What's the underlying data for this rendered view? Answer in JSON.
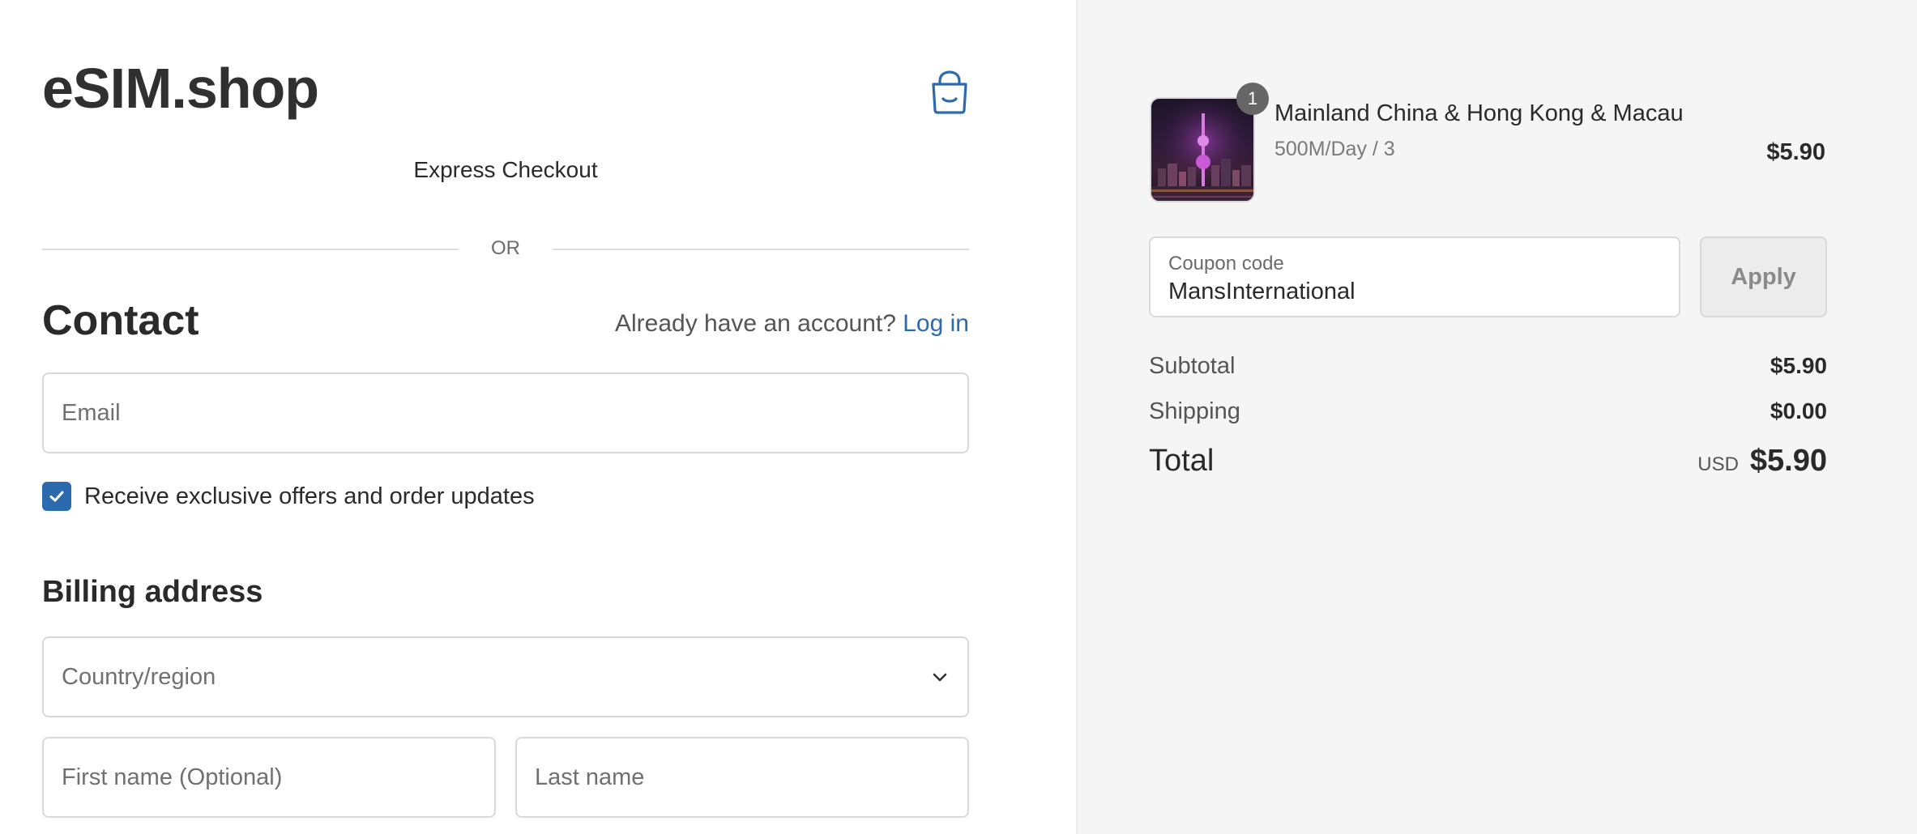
{
  "brand": {
    "logo_text": "eSIM.shop",
    "accent_color": "#2c6ab0"
  },
  "header": {
    "cart_icon": "shopping-bag-icon"
  },
  "express_checkout": {
    "label": "Express Checkout",
    "divider_text": "OR"
  },
  "contact": {
    "title": "Contact",
    "account_prompt": "Already have an account?",
    "login_link": "Log in",
    "email_placeholder": "Email",
    "offers_label": "Receive exclusive offers and order updates",
    "offers_checked": true
  },
  "billing": {
    "title": "Billing address",
    "country_placeholder": "Country/region",
    "first_name_placeholder": "First name (Optional)",
    "last_name_placeholder": "Last name"
  },
  "order_summary": {
    "item": {
      "name": "Mainland China & Hong Kong & Macau",
      "variant": "500M/Day / 3",
      "price": "$5.90",
      "quantity": "1"
    },
    "coupon": {
      "label": "Coupon code",
      "value": "MansInternational",
      "apply_label": "Apply"
    },
    "subtotal_label": "Subtotal",
    "subtotal_value": "$5.90",
    "shipping_label": "Shipping",
    "shipping_value": "$0.00",
    "total_label": "Total",
    "currency": "USD",
    "total_value": "$5.90"
  }
}
